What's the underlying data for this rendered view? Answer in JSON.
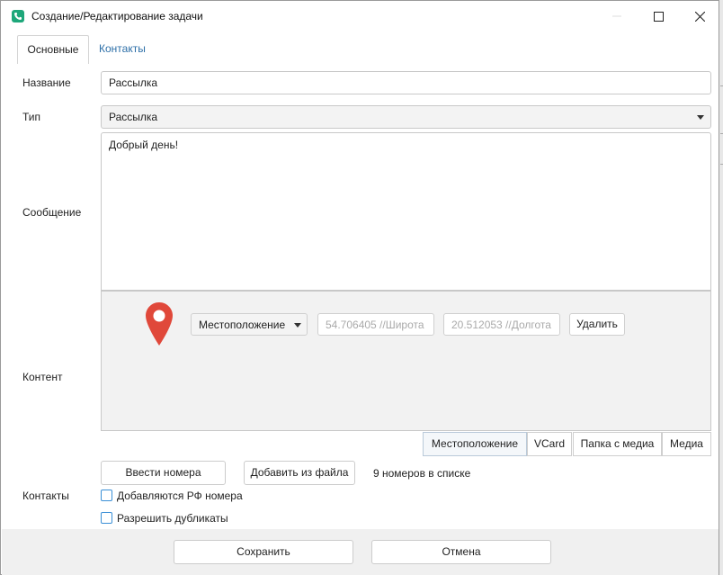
{
  "window": {
    "title": "Создание/Редактирование задачи"
  },
  "tabs": [
    {
      "label": "Основные"
    },
    {
      "label": "Контакты"
    }
  ],
  "form": {
    "name_label": "Название",
    "name_value": "Рассылка",
    "type_label": "Тип",
    "type_value": "Рассылка",
    "message_label": "Сообщение",
    "message_value": "Добрый день!",
    "content_label": "Контент",
    "contacts_label": "Контакты"
  },
  "content": {
    "kind_select": "Местоположение",
    "latitude": "54.706405 //Широта",
    "longitude": "20.512053 //Долгота",
    "delete_label": "Удалить",
    "type_buttons": [
      "Местоположение",
      "VCard",
      "Папка с медиа",
      "Медиа"
    ]
  },
  "contacts": {
    "enter_numbers": "Ввести номера",
    "add_from_file": "Добавить из файла",
    "count_text": "9 номеров в списке",
    "add_rf_label": "Добавляются РФ номера",
    "allow_dup_label": "Разрешить дубликаты"
  },
  "footer": {
    "save_label": "Сохранить",
    "cancel_label": "Отмена"
  },
  "colors": {
    "accent": "#1ea77a",
    "link": "#2d6fa8",
    "pin": "#e0483a",
    "checkbox": "#3a8fd6"
  }
}
